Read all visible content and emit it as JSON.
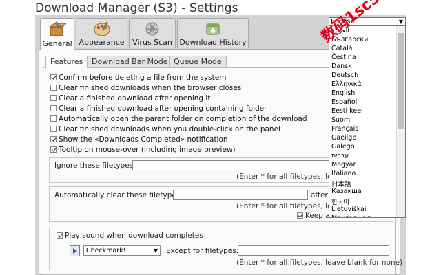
{
  "window": {
    "title": "Download Manager (S3) - Settings"
  },
  "tabs": [
    {
      "label": "General",
      "icon": "wrench-box-icon",
      "active": true
    },
    {
      "label": "Appearance",
      "icon": "palette-icon",
      "active": false
    },
    {
      "label": "Virus Scan",
      "icon": "biohazard-icon",
      "active": false
    },
    {
      "label": "Download History",
      "icon": "download-history-icon",
      "active": false
    }
  ],
  "subtabs": [
    {
      "label": "Features",
      "active": true
    },
    {
      "label": "Download Bar Mode",
      "active": false
    },
    {
      "label": "Queue Mode",
      "active": false
    }
  ],
  "options": [
    {
      "label": "Confirm before deleting a file from the system",
      "checked": true
    },
    {
      "label": "Clear finished downloads when the browser closes",
      "checked": false
    },
    {
      "label": "Clear a finished download after opening it",
      "checked": false
    },
    {
      "label": "Clear a finished download after opening containing folder",
      "checked": false
    },
    {
      "label": "Automatically open the parent folder on completion of the download",
      "checked": false
    },
    {
      "label": "Clear finished downloads when you double-click on the panel",
      "checked": false
    },
    {
      "label": "Show the «Downloads Completed» notification",
      "checked": true
    },
    {
      "label": "Tooltip on mouse-over (including image preview)",
      "checked": true
    }
  ],
  "ignore": {
    "label": "Ignore these filetypes:",
    "value": "",
    "hint": "(Enter * for all filetypes, leav"
  },
  "autoclear": {
    "label": "Automatically clear these filetypes",
    "value": "",
    "after_label": "after",
    "hint": "(Enter * for all filetypes, leav",
    "keep_label": "Keep a",
    "keep_checked": true
  },
  "sound": {
    "label": "Play sound when download completes",
    "checked": true,
    "selected": "Checkmark!",
    "except_label": "Except for filetypes:",
    "except_value": "",
    "hint": "(Enter * for all filetypes, leave blank for none)"
  },
  "language": {
    "selected": "English",
    "options": [
      "العربية",
      "Български",
      "Català",
      "Čeština",
      "Dansk",
      "Deutsch",
      "Ελληνικά",
      "English",
      "Español",
      "Eesti keel",
      "Suomi",
      "Français",
      "Gaeilge",
      "Galego",
      "עברית",
      "Magyar",
      "Italiano",
      "日本語",
      "Қазақша",
      "한국어",
      "Lietuviškai",
      "Монгол хэл"
    ]
  },
  "watermark": "数码1sc566",
  "colors": {
    "frame": "#d3d3d3",
    "panel": "#fafafa",
    "watermark": "#e2001a"
  }
}
